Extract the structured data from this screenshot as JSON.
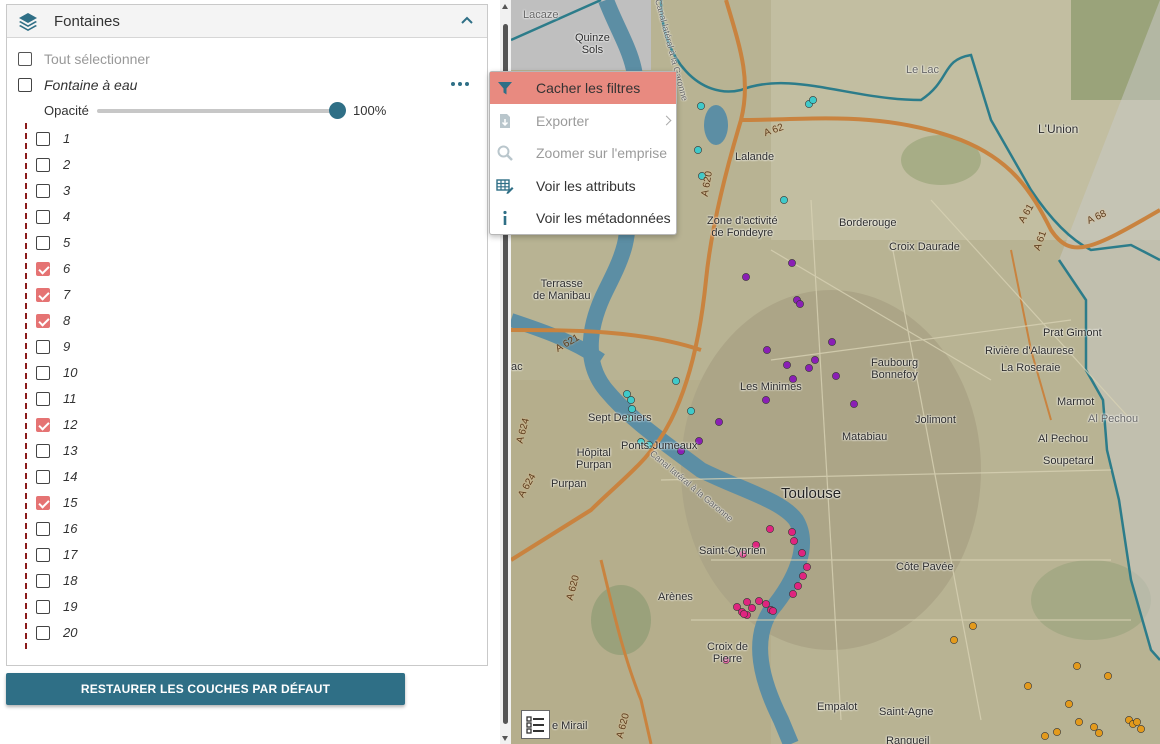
{
  "layer_panel": {
    "title": "Fontaines",
    "select_all_label": "Tout sélectionner",
    "layer_name": "Fontaine à eau",
    "opacity_label": "Opacité",
    "opacity_value": "100%",
    "opacity_fraction": 1.0,
    "values": [
      {
        "label": "1",
        "checked": false
      },
      {
        "label": "2",
        "checked": false
      },
      {
        "label": "3",
        "checked": false
      },
      {
        "label": "4",
        "checked": false
      },
      {
        "label": "5",
        "checked": false
      },
      {
        "label": "6",
        "checked": true
      },
      {
        "label": "7",
        "checked": true
      },
      {
        "label": "8",
        "checked": true
      },
      {
        "label": "9",
        "checked": false
      },
      {
        "label": "10",
        "checked": false
      },
      {
        "label": "11",
        "checked": false
      },
      {
        "label": "12",
        "checked": true
      },
      {
        "label": "13",
        "checked": false
      },
      {
        "label": "14",
        "checked": false
      },
      {
        "label": "15",
        "checked": true
      },
      {
        "label": "16",
        "checked": false
      },
      {
        "label": "17",
        "checked": false
      },
      {
        "label": "18",
        "checked": false
      },
      {
        "label": "19",
        "checked": false
      },
      {
        "label": "20",
        "checked": false
      }
    ],
    "restore_button": "RESTAURER LES COUCHES PAR DÉFAUT"
  },
  "context_menu": {
    "items": [
      {
        "label": "Cacher les filtres",
        "icon": "filter-icon",
        "state": "active"
      },
      {
        "label": "Exporter",
        "icon": "export-icon",
        "state": "disabled",
        "submenu": true
      },
      {
        "label": "Zoomer sur l'emprise",
        "icon": "zoom-icon",
        "state": "disabled"
      },
      {
        "label": "Voir les attributs",
        "icon": "table-edit-icon",
        "state": "normal"
      },
      {
        "label": "Voir les métadonnées",
        "icon": "info-icon",
        "state": "normal"
      }
    ]
  },
  "map": {
    "labels": {
      "quinze_sols": "Quinze\nSols",
      "lacaze": "Lacaze",
      "le_lac": "Le Lac",
      "lunion": "L'Union",
      "lalande": "Lalande",
      "zone_fondeyre": "Zone d'activité\nde Fondeyre",
      "borderouge": "Borderouge",
      "croix_daurade": "Croix Daurade",
      "terrasse": "Terrasse\nde Manibau",
      "prat_gimont": "Prat Gimont",
      "faubourg": "Faubourg\nBonnefoy",
      "riviere": "Rivière d'Alaurese",
      "la_roseraie": "La Roseraie",
      "les_minimes": "Les Minimes",
      "marmot": "Marmot",
      "al_pechou": "Al Pechou",
      "sept_deniers": "Sept Deniers",
      "jolimont": "Jolimont",
      "ponts_jumeaux": "Ponts-Jumeaux",
      "matabiau": "Matabiau",
      "hopital_purpan": "Hôpital\nPurpan",
      "soupetard": "Soupetard",
      "purpan": "Purpan",
      "toulouse": "Toulouse",
      "saint_cyprien": "Saint-Cyprien",
      "cote_pavee": "Côte Pavée",
      "arenes": "Arènes",
      "croix_pierre": "Croix de\nPierre",
      "empalot": "Empalot",
      "saint_agne": "Saint-Agne",
      "mirail": "e Mirail",
      "rangueil": "Rangueil",
      "a62": "A 62",
      "a620": "A 620",
      "a621": "A 621",
      "a624": "A 624",
      "a61": "A 61",
      "a68": "A 68",
      "canal": "Canal latéral à la Garonne",
      "garonne_canal": "Canal latéral à la Garonne",
      "ac": "ac"
    }
  }
}
